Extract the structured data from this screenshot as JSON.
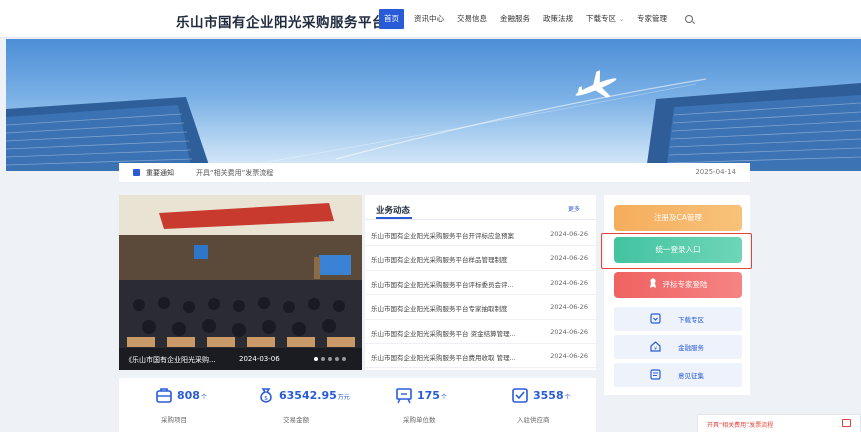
{
  "header": {
    "site_title": "乐山市国有企业阳光采购服务平台",
    "nav": [
      {
        "label": "首页",
        "active": true
      },
      {
        "label": "资讯中心"
      },
      {
        "label": "交易信息"
      },
      {
        "label": "金融服务"
      },
      {
        "label": "政策法规"
      },
      {
        "label": "下载专区",
        "has_dropdown": true
      },
      {
        "label": "专家管理"
      }
    ],
    "search_icon": "search-icon"
  },
  "notice": {
    "label": "重要通知",
    "text": "开具“相关费用”发票流程",
    "date": "2025-04-14"
  },
  "carousel": {
    "caption": "《乐山市国有企业阳光采购...",
    "date": "2024-03-06",
    "dot_count": 5,
    "active_dot": 1
  },
  "news": {
    "title": "业务动态",
    "more": "更多",
    "items": [
      {
        "title": "乐山市国有企业阳光采购服务平台开评标应急预案",
        "date": "2024-06-26"
      },
      {
        "title": "乐山市国有企业阳光采购服务平台样品管理制度",
        "date": "2024-06-26"
      },
      {
        "title": "乐山市国有企业阳光采购服务平台评标委员会评...",
        "date": "2024-06-26"
      },
      {
        "title": "乐山市国有企业阳光采购服务平台专家抽取制度",
        "date": "2024-06-26"
      },
      {
        "title": "乐山市国有企业阳光采购服务平台 资金结算管理...",
        "date": "2024-06-26"
      },
      {
        "title": "乐山市国有企业阳光采购服务平台费用收取 管理...",
        "date": "2024-06-26"
      }
    ]
  },
  "stats": [
    {
      "value": "808",
      "unit": "个",
      "label": "采购项目",
      "icon": "bag-icon"
    },
    {
      "value": "63542.95",
      "unit": "万元",
      "label": "交易金额",
      "icon": "money-bag-icon"
    },
    {
      "value": "175",
      "unit": "个",
      "label": "采购单位数",
      "icon": "building-icon"
    },
    {
      "value": "3558",
      "unit": "个",
      "label": "入驻供应商",
      "icon": "supplier-icon"
    }
  ],
  "side": {
    "ca_button": "注册及CA管理",
    "login_button": "统一登录入口",
    "expert_button": "评标专家登陆",
    "links": [
      {
        "label": "下载专区",
        "icon": "download-icon"
      },
      {
        "label": "金融服务",
        "icon": "finance-icon"
      },
      {
        "label": "意见征集",
        "icon": "feedback-icon"
      }
    ]
  },
  "floating_tip": {
    "text": "开具“相关费用”发票流程",
    "icon": "message-icon"
  },
  "colors": {
    "brand": "#2a5bd7",
    "orange": "#f5ad5c",
    "green": "#43c3a0",
    "red": "#ef6262",
    "highlight": "#e2443b"
  }
}
